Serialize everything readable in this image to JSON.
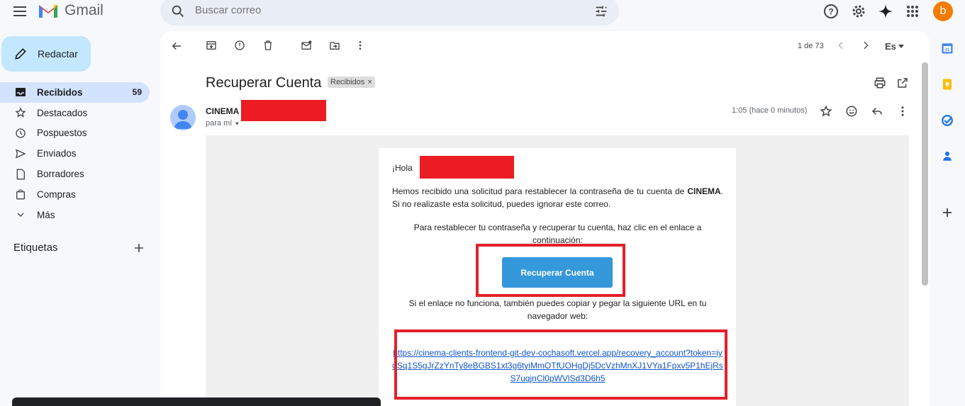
{
  "app": {
    "name": "Gmail"
  },
  "search": {
    "placeholder": "Buscar correo"
  },
  "account": {
    "initial": "b"
  },
  "sidebar": {
    "compose_label": "Redactar",
    "items": [
      {
        "label": "Recibidos",
        "count": "59",
        "icon": "inbox-icon"
      },
      {
        "label": "Destacados",
        "icon": "star-icon"
      },
      {
        "label": "Pospuestos",
        "icon": "clock-icon"
      },
      {
        "label": "Enviados",
        "icon": "send-icon"
      },
      {
        "label": "Borradores",
        "icon": "draft-icon"
      },
      {
        "label": "Compras",
        "icon": "bag-icon"
      },
      {
        "label": "Más",
        "icon": "chevron-down-icon"
      }
    ],
    "labels_heading": "Etiquetas"
  },
  "toolbar": {
    "page_count": "1 de 73",
    "lang": "Es"
  },
  "message": {
    "subject": "Recuperar Cuenta",
    "label_chip": "Recibidos",
    "sender": "CINEMA",
    "to": "para mí",
    "time": "1:05 (hace 0 minutos)"
  },
  "email": {
    "greeting": "¡Hola ",
    "greeting_end": "!",
    "para1_a": "Hemos recibido una solicitud para restablecer la contraseña de tu cuenta de ",
    "para1_brand": "CINEMA",
    "para1_b": ". Si no realizaste esta solicitud, puedes ignorar este correo.",
    "para2": "Para restablecer tu contraseña y recuperar tu cuenta, haz clic en el enlace a continuación:",
    "cta_label": "Recuperar Cuenta",
    "para3": "Si el enlace no funciona, también puedes copiar y pegar la siguiente URL en tu navegador web:",
    "url": "https://cinema-clients-frontend-git-dev-cochasoft.vercel.app/recovery_account?token=iydSq1S5gJrZzYnTy8eBGBS1xt3g6tyiMmOTfUOHgDj5DcVzhMnXJ1VYa1Fpxv5P1hEjRsS7uqjnCl0pWVlSd3D6h5"
  },
  "colors": {
    "accent": "#0b57d0",
    "compose_bg": "#c2e7ff",
    "active_nav": "#d3e3fd",
    "cta": "#3498db",
    "highlight_box": "#e3202a"
  }
}
